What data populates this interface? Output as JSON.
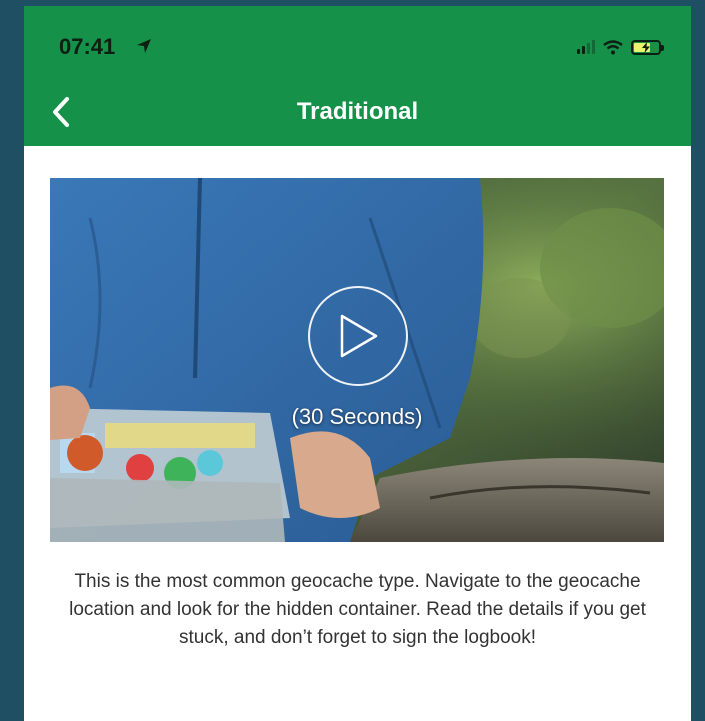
{
  "status_bar": {
    "time": "07:41",
    "icons": [
      "location-arrow-icon",
      "signal-icon",
      "wifi-icon",
      "battery-charging-icon"
    ]
  },
  "nav": {
    "title": "Traditional",
    "back_icon": "chevron-left-icon"
  },
  "video": {
    "duration_label": "(30 Seconds)",
    "play_icon": "play-icon"
  },
  "description": "This is the most common geocache type. Navigate to the geocache location and look for the hidden container. Read the details if you get stuck, and don’t forget to sign the logbook!",
  "colors": {
    "header_green": "#16914a",
    "background": "#1f4f63",
    "text": "#333333"
  }
}
